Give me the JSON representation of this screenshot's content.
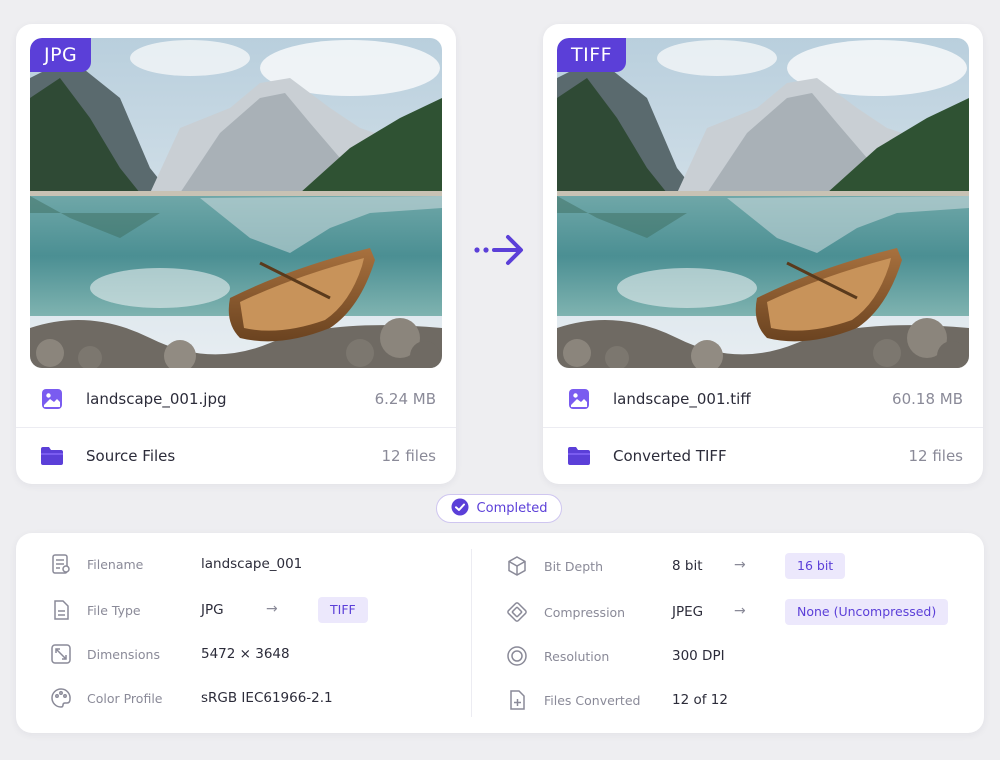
{
  "source": {
    "format": "JPG",
    "filename": "landscape_001.jpg",
    "size": "6.24 MB",
    "folder": "Source Files",
    "folder_count": "12 files"
  },
  "target": {
    "format": "TIFF",
    "filename": "landscape_001.tiff",
    "size": "60.18 MB",
    "folder": "Converted TIFF",
    "folder_count": "12 files"
  },
  "status": {
    "label": "Completed"
  },
  "details": {
    "left": [
      {
        "label": "Filename",
        "icon": "document-icon",
        "value": "landscape_001"
      },
      {
        "label": "File Type",
        "icon": "file-icon",
        "value": "JPG",
        "arrow": "→",
        "new_value": "TIFF"
      },
      {
        "label": "Dimensions",
        "icon": "resize-icon",
        "value": "5472 × 3648"
      },
      {
        "label": "Color Profile",
        "icon": "palette-icon",
        "value": "sRGB IEC61966-2.1"
      }
    ],
    "right": [
      {
        "label": "Bit Depth",
        "icon": "cube-icon",
        "value": "8 bit",
        "arrow": "→",
        "new_value": "16 bit"
      },
      {
        "label": "Compression",
        "icon": "compress-icon",
        "value": "JPEG",
        "arrow": "→",
        "new_value": "None (Uncompressed)"
      },
      {
        "label": "Resolution",
        "icon": "target-icon",
        "value": "300 DPI"
      },
      {
        "label": "Files Converted",
        "icon": "file-plus-icon",
        "value": "12 of 12"
      }
    ]
  },
  "colors": {
    "accent": "#5b3fd8",
    "tag_bg": "#ece8fc",
    "page_bg": "#eeeef1"
  }
}
